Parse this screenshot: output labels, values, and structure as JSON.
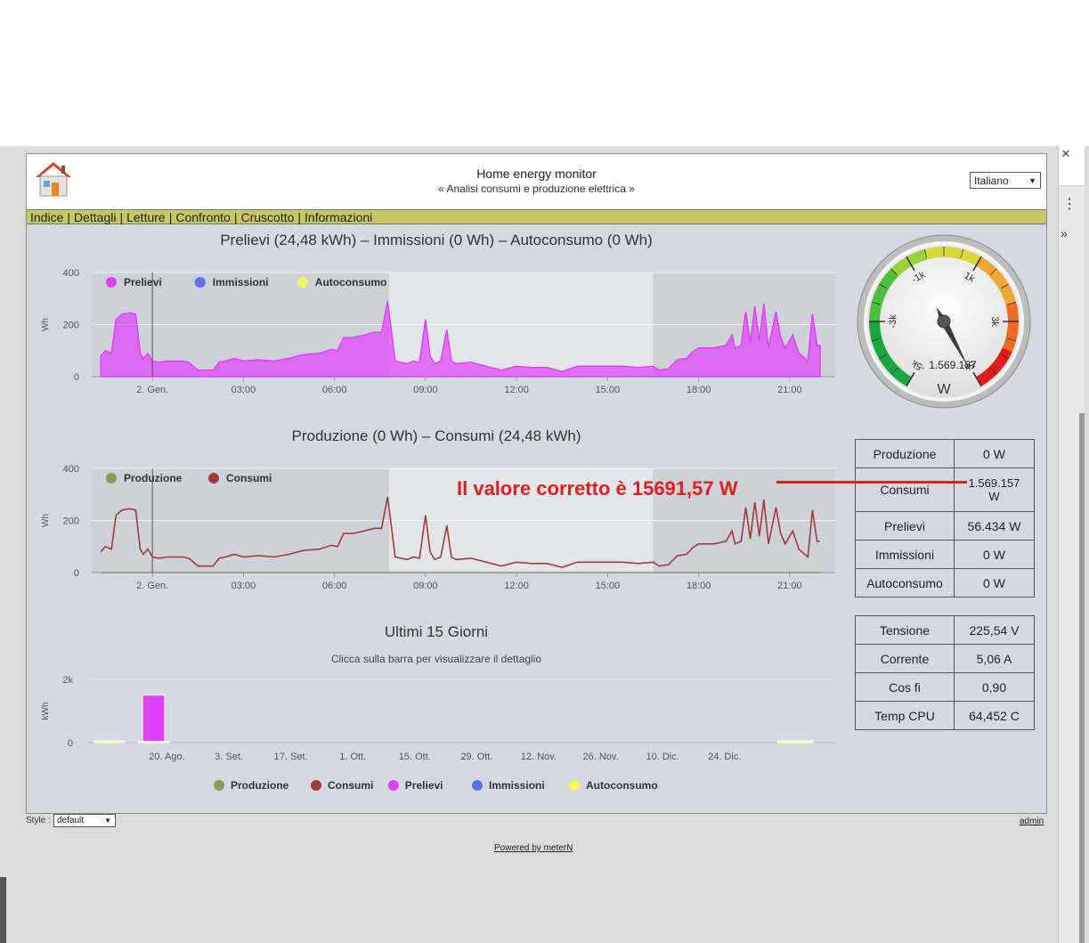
{
  "header": {
    "title": "Home energy monitor",
    "subtitle": "« Analisi consumi e produzione elettrica »",
    "language": "Italiano"
  },
  "nav": {
    "items": [
      "Indice",
      "Dettagli",
      "Letture",
      "Confronto",
      "Cruscotto",
      "Informazioni"
    ]
  },
  "annotation": "Il valore corretto è 15691,57 W",
  "gauge": {
    "value_label": "1.569.157",
    "unit": "W",
    "tick_labels": [
      "-5k",
      "-3k",
      "-1k",
      "1k",
      "3k",
      "5k"
    ],
    "min": -5000,
    "max": 5000,
    "needle_value": 1569.157
  },
  "power_table": {
    "rows": [
      {
        "label": "Produzione",
        "value": "0 W"
      },
      {
        "label": "Consumi",
        "value": "1.569.157 W"
      },
      {
        "label": "Prelievi",
        "value": "56.434 W"
      },
      {
        "label": "Immissioni",
        "value": "0 W"
      },
      {
        "label": "Autoconsumo",
        "value": "0 W"
      }
    ]
  },
  "system_table": {
    "rows": [
      {
        "label": "Tensione",
        "value": "225,54 V"
      },
      {
        "label": "Corrente",
        "value": "5,06 A"
      },
      {
        "label": "Cos fi",
        "value": "0,90"
      },
      {
        "label": "Temp CPU",
        "value": "64,452 C"
      }
    ]
  },
  "footer": {
    "style_label": "Style :",
    "style_value": "default",
    "admin": "admin",
    "powered": "Powered by meterN"
  },
  "colors": {
    "prelievi": "#e040fb",
    "immissioni": "#5b6ef5",
    "autoconsumo": "#f5f55b",
    "produzione": "#8a9a58",
    "consumi": "#a23b3b",
    "accent": "#c7c765"
  },
  "chart_data": [
    {
      "type": "area",
      "title": "Prelievi (24,48 kWh) – Immissioni (0 Wh) – Autoconsumo (0 Wh)",
      "ylabel": "Wh",
      "ylim": [
        0,
        400
      ],
      "yticks": [
        "0",
        "200",
        "400"
      ],
      "xticks": [
        "2. Gen.",
        "03:00",
        "06:00",
        "09:00",
        "12:00",
        "15:00",
        "18:00",
        "21:00"
      ],
      "xtick_hours": [
        0,
        3,
        6,
        9,
        12,
        15,
        18,
        21
      ],
      "xrange_hours": [
        -2,
        22.5
      ],
      "shaded_hours": [
        [
          -2,
          7.8
        ],
        [
          16.5,
          22.5
        ]
      ],
      "cursor_hour": 0,
      "legend": [
        "Prelievi",
        "Immissioni",
        "Autoconsumo"
      ],
      "series": [
        {
          "name": "Prelievi",
          "points": [
            [
              -1.7,
              80
            ],
            [
              -1.55,
              100
            ],
            [
              -1.35,
              90
            ],
            [
              -1.2,
              220
            ],
            [
              -1.0,
              240
            ],
            [
              -0.75,
              245
            ],
            [
              -0.55,
              240
            ],
            [
              -0.4,
              90
            ],
            [
              -0.3,
              70
            ],
            [
              -0.15,
              90
            ],
            [
              0.0,
              60
            ],
            [
              0.2,
              55
            ],
            [
              0.5,
              60
            ],
            [
              1.0,
              60
            ],
            [
              1.2,
              55
            ],
            [
              1.5,
              25
            ],
            [
              2.0,
              25
            ],
            [
              2.2,
              55
            ],
            [
              2.4,
              60
            ],
            [
              2.7,
              70
            ],
            [
              3.0,
              60
            ],
            [
              3.5,
              65
            ],
            [
              4.0,
              60
            ],
            [
              4.5,
              70
            ],
            [
              4.8,
              80
            ],
            [
              5.0,
              85
            ],
            [
              5.5,
              90
            ],
            [
              5.9,
              105
            ],
            [
              6.1,
              100
            ],
            [
              6.3,
              150
            ],
            [
              6.6,
              150
            ],
            [
              7.0,
              160
            ],
            [
              7.3,
              170
            ],
            [
              7.55,
              170
            ],
            [
              7.75,
              290
            ],
            [
              7.85,
              200
            ],
            [
              8.0,
              60
            ],
            [
              8.4,
              50
            ],
            [
              8.6,
              60
            ],
            [
              8.8,
              55
            ],
            [
              9.0,
              220
            ],
            [
              9.15,
              80
            ],
            [
              9.3,
              50
            ],
            [
              9.5,
              60
            ],
            [
              9.7,
              180
            ],
            [
              9.85,
              60
            ],
            [
              10.0,
              50
            ],
            [
              10.5,
              55
            ],
            [
              11.0,
              40
            ],
            [
              11.5,
              25
            ],
            [
              12.0,
              40
            ],
            [
              12.5,
              35
            ],
            [
              13.0,
              35
            ],
            [
              13.5,
              20
            ],
            [
              14.0,
              40
            ],
            [
              14.5,
              40
            ],
            [
              15.0,
              40
            ],
            [
              15.5,
              40
            ],
            [
              16.0,
              35
            ],
            [
              16.5,
              40
            ],
            [
              16.7,
              25
            ],
            [
              17.0,
              30
            ],
            [
              17.3,
              65
            ],
            [
              17.6,
              70
            ],
            [
              17.8,
              95
            ],
            [
              18.0,
              110
            ],
            [
              18.5,
              110
            ],
            [
              18.9,
              120
            ],
            [
              19.1,
              160
            ],
            [
              19.2,
              110
            ],
            [
              19.4,
              120
            ],
            [
              19.55,
              250
            ],
            [
              19.7,
              130
            ],
            [
              19.85,
              270
            ],
            [
              20.0,
              140
            ],
            [
              20.15,
              280
            ],
            [
              20.3,
              110
            ],
            [
              20.55,
              250
            ],
            [
              20.7,
              150
            ],
            [
              20.85,
              110
            ],
            [
              21.1,
              160
            ],
            [
              21.3,
              90
            ],
            [
              21.6,
              60
            ],
            [
              21.75,
              240
            ],
            [
              21.9,
              120
            ],
            [
              22.0,
              120
            ]
          ]
        }
      ]
    },
    {
      "type": "line",
      "title": "Produzione (0 Wh) – Consumi (24,48 kWh)",
      "ylabel": "Wh",
      "ylim": [
        0,
        400
      ],
      "yticks": [
        "0",
        "200",
        "400"
      ],
      "xticks": [
        "2. Gen.",
        "03:00",
        "06:00",
        "09:00",
        "12:00",
        "15:00",
        "18:00",
        "21:00"
      ],
      "xtick_hours": [
        0,
        3,
        6,
        9,
        12,
        15,
        18,
        21
      ],
      "xrange_hours": [
        -2,
        22.5
      ],
      "shaded_hours": [
        [
          -2,
          7.8
        ],
        [
          16.5,
          22.5
        ]
      ],
      "cursor_hour": 0,
      "legend": [
        "Produzione",
        "Consumi"
      ],
      "series": [
        {
          "name": "Produzione",
          "points": [
            [
              -1.7,
              0
            ],
            [
              22.0,
              0
            ]
          ]
        },
        {
          "name": "Consumi",
          "same_as": 0
        }
      ]
    },
    {
      "type": "bar",
      "title": "Ultimi 15 Giorni",
      "subtitle": "Clicca sulla barra per visualizzare il dettaglio",
      "ylabel": "kWh",
      "ylim": [
        0,
        2000
      ],
      "yticks": [
        "0",
        "2k"
      ],
      "xticks": [
        "20. Ago.",
        "3. Set.",
        "17. Set.",
        "1. Ott.",
        "15. Ott.",
        "29. Ott.",
        "12. Nov.",
        "26. Nov.",
        "10. Dic.",
        "24. Dic."
      ],
      "legend": [
        "Produzione",
        "Consumi",
        "Prelievi",
        "Immissioni",
        "Autoconsumo"
      ],
      "bars": [
        {
          "series": "Autoconsumo",
          "day": -7,
          "value": 60,
          "width_days": 7
        },
        {
          "series": "Prelievi",
          "day": 3,
          "value": 1500,
          "width_days": 5
        },
        {
          "series": "Autoconsumo",
          "day": 3,
          "value": 40,
          "width_days": 7
        },
        {
          "series": "Autoconsumo",
          "day": 148,
          "value": 60,
          "width_days": 8
        }
      ]
    }
  ]
}
